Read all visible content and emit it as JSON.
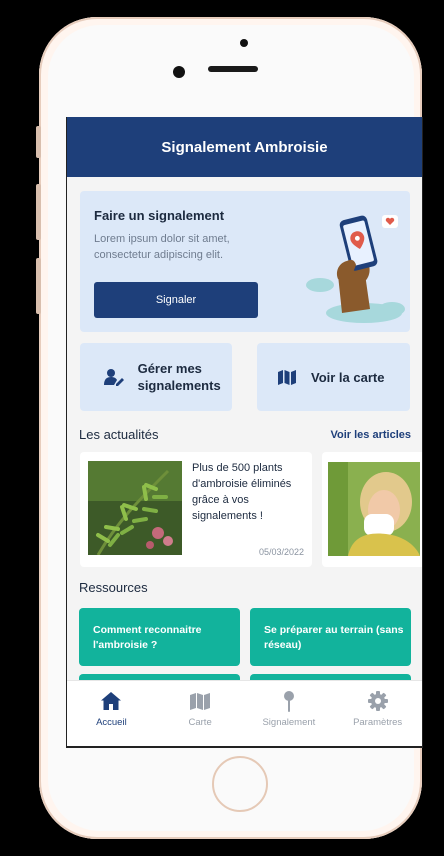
{
  "app": {
    "title": "Signalement Ambroisie"
  },
  "report_card": {
    "title": "Faire un signalement",
    "text": "Lorem ipsum dolor sit amet, consectetur adipiscing elit.",
    "button": "Signaler",
    "illustration": "hand-holding-phone-map-pin"
  },
  "quick_actions": [
    {
      "label": "Gérer mes signalements",
      "icon": "user-edit-icon"
    },
    {
      "label": "Voir la carte",
      "icon": "map-icon"
    }
  ],
  "news": {
    "title": "Les actualités",
    "link": "Voir les articles",
    "items": [
      {
        "text": "Plus de 500 plants d'ambroisie éliminés grâce à vos signalements !",
        "date": "05/03/2022",
        "image": "ragweed-plant-photo"
      },
      {
        "text": "",
        "date": "",
        "image": "woman-sneezing-photo"
      }
    ]
  },
  "resources": {
    "title": "Ressources",
    "items": [
      {
        "label": "Comment reconnaitre l'ambroisie ?"
      },
      {
        "label": "Se préparer au terrain (sans réseau)"
      },
      {
        "label": ""
      },
      {
        "label": ""
      }
    ]
  },
  "tabs": [
    {
      "label": "Accueil",
      "icon": "home-icon",
      "active": true
    },
    {
      "label": "Carte",
      "icon": "map-icon",
      "active": false
    },
    {
      "label": "Signalement",
      "icon": "map-pin-icon",
      "active": false
    },
    {
      "label": "Paramètres",
      "icon": "gear-icon",
      "active": false
    }
  ],
  "colors": {
    "primary": "#1e3f7a",
    "accent": "#12b39c",
    "card": "#dce8f8",
    "inactive": "#9aa1ab"
  }
}
